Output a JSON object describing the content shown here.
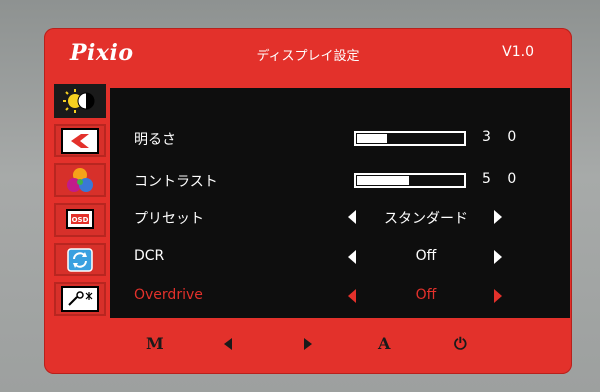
{
  "header": {
    "logo": "Pixio",
    "title": "ディスプレイ設定",
    "version": "V1.0"
  },
  "sidebar": {
    "items": [
      {
        "name": "brightness-contrast-icon",
        "active": true
      },
      {
        "name": "input-source-icon",
        "active": false
      },
      {
        "name": "color-icon",
        "active": false
      },
      {
        "name": "osd-icon",
        "active": false
      },
      {
        "name": "reset-icon",
        "active": false
      },
      {
        "name": "misc-settings-icon",
        "active": false
      }
    ]
  },
  "menu": {
    "brightness": {
      "label": "明るさ",
      "value": "3 0",
      "level": 30
    },
    "contrast": {
      "label": "コントラスト",
      "value": "5 0",
      "level": 50
    },
    "preset": {
      "label": "プリセット",
      "value": "スタンダード"
    },
    "dcr": {
      "label": "DCR",
      "value": "Off"
    },
    "overdrive": {
      "label": "Overdrive",
      "value": "Off"
    }
  },
  "footer": {
    "menu_key": "M",
    "auto_key": "A",
    "power_key": "⏻"
  },
  "colors": {
    "accent": "#e3312b",
    "background": "#0e0e0e",
    "text": "#ffffff"
  }
}
